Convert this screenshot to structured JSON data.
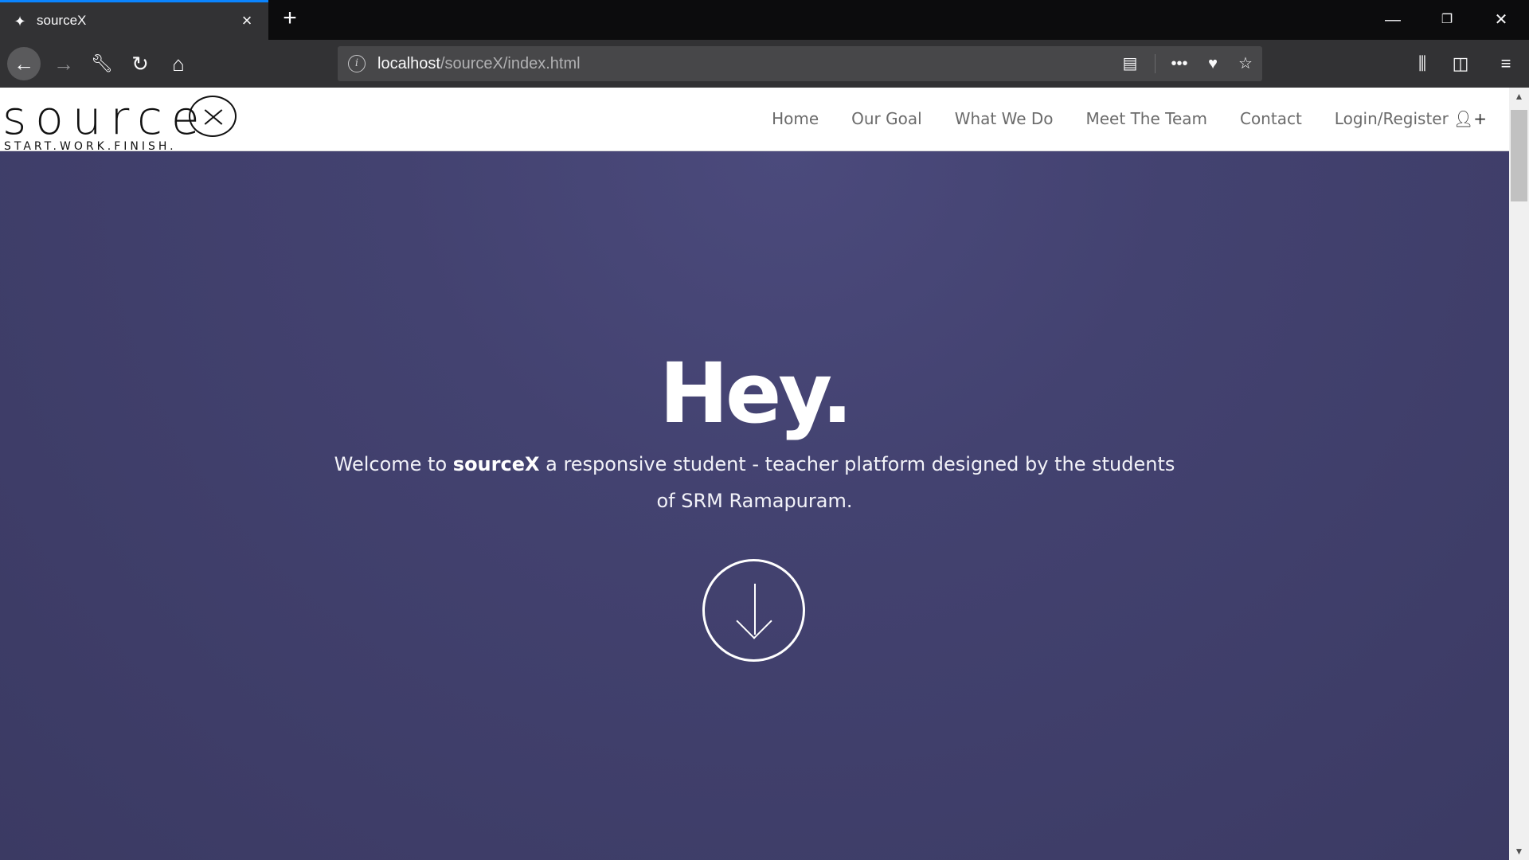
{
  "browser": {
    "tab": {
      "title": "sourceX",
      "favicon": "puzzle-icon"
    },
    "window_controls": [
      "minimize-icon",
      "restore-icon",
      "close-icon"
    ],
    "url": {
      "host": "localhost",
      "path": "/sourceX/index.html"
    },
    "accent": "#0a84ff"
  },
  "site": {
    "logo": {
      "word": "source",
      "tagline": "START.WORK.FINISH."
    },
    "menu": [
      "Home",
      "Our Goal",
      "What We Do",
      "Meet The Team",
      "Contact",
      "Login/Register"
    ],
    "hero": {
      "title": "Hey.",
      "intro_before": "Welcome to ",
      "intro_brand": "sourceX",
      "intro_after": " a responsive student - teacher platform designed by the students of SRM Ramapuram."
    },
    "colors": {
      "hero_bg": "#434270",
      "menu_text": "#6b6b6b"
    }
  }
}
